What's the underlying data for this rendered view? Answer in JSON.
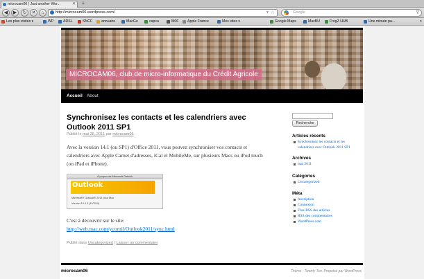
{
  "browser": {
    "tab_title": "microcam06 | Just another Wor...",
    "url": "http://microcam06.wordpress.com/",
    "search_placeholder": "Google",
    "bookmarks": [
      {
        "label": "Les plus visités ▾",
        "color": "#d04a2a"
      },
      {
        "label": "WP",
        "color": "#2a6db5"
      },
      {
        "label": "ADSL",
        "color": "#2a6db5"
      },
      {
        "label": "SNCF",
        "color": "#c0392b"
      },
      {
        "label": "annuaire",
        "color": "#e3a21a"
      },
      {
        "label": "MacGe",
        "color": "#2a6db5"
      },
      {
        "label": "capca",
        "color": "#3a8f3a"
      },
      {
        "label": "M06",
        "color": "#555555"
      },
      {
        "label": "Apple France",
        "color": "#888888"
      },
      {
        "label": "Mes sites ▾",
        "color": "#2a6db5"
      },
      {
        "label": "Google Maps",
        "color": "#3a8f3a"
      },
      {
        "label": "MacBU",
        "color": "#2a6db5"
      },
      {
        "label": "FrogZ HUB",
        "color": "#3a8f3a"
      },
      {
        "label": "Une minute pa...",
        "color": "#2a6db5"
      }
    ]
  },
  "site": {
    "header_title": "MICROCAM06, club de micro-informatique du Crédit Agricole",
    "menu": [
      "Accueil",
      "About"
    ]
  },
  "post": {
    "title": "Synchronisez les contacts et les calendriers avec Outlook 2011 SP1",
    "meta_prefix": "Publié le",
    "meta_date": "mai 25, 2011",
    "meta_by": "par",
    "meta_author": "microcam06",
    "body": "Avec la version 14.1 (ou SP1) d'Office 2011, vous pouvez synchroniser vos contacts et calendriers avec Apple Carnet d'adresses, iCal et MobileMe, sur plusieurs Macs ou iPod touch (ou iPad et iPhone).",
    "image": {
      "window_title": "À propos de Microsoft Outlook",
      "logo": "Outlook",
      "line1": "Microsoft® Outlook® 2011 pour Mac",
      "line2": "Version 14.1.0 (110310)"
    },
    "discover_text": "C'est à découvrir sur le site:",
    "link": "http://web.mac.com/ycornil/Outlook2011/sync.html",
    "utility_prefix": "Publié dans",
    "category": "Uncategorized",
    "separator": "|",
    "comment_link": "Laisser un commentaire"
  },
  "sidebar": {
    "search_button": "Recherche",
    "recent_heading": "Articles récents",
    "recent_items": [
      "Synchronisez les contacts et les calendriers avec Outlook 2011 SP1"
    ],
    "archives_heading": "Archives",
    "archives_items": [
      "mai 2011"
    ],
    "categories_heading": "Catégories",
    "categories_items": [
      "Uncategorized"
    ],
    "meta_heading": "Méta",
    "meta_items": [
      "Inscription",
      "Connexion",
      "Flux RSS des articles",
      "RSS des commentaires",
      "WordPress.com"
    ]
  },
  "footer": {
    "site_name": "microcam06",
    "credit": "Thème : Twenty Ten. Propulsé par WordPress"
  }
}
